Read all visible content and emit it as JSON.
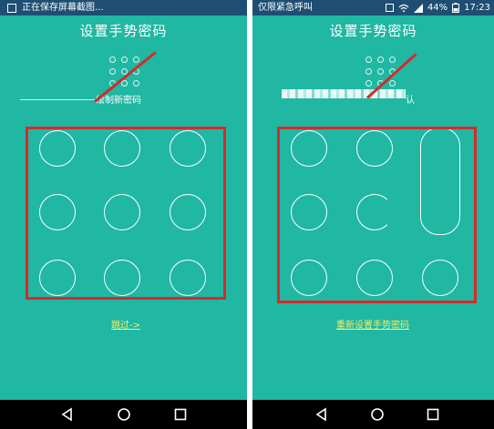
{
  "left_screen": {
    "status_text": "正在保存屏幕截图...",
    "title": "设置手势密码",
    "hint": "绘制新密码",
    "action_link": "跳过->"
  },
  "right_screen": {
    "status_text": "仅限紧急呼叫",
    "battery": "44%",
    "time": "17:23",
    "title": "设置手势密码",
    "hint": "认",
    "action_link": "重新设置手势密码"
  },
  "icons": {
    "status_screenshot": "screenshot-icon",
    "status_wifi": "wifi-icon",
    "status_signal": "signal-icon",
    "status_battery": "battery-icon",
    "nav_back": "back-triangle-icon",
    "nav_home": "home-circle-icon",
    "nav_recent": "recent-square-icon"
  },
  "colors": {
    "background": "#20b7a3",
    "status_bar": "#1e4f73",
    "annotation_red": "#d62a2a",
    "link_yellow": "#f3f06a"
  }
}
